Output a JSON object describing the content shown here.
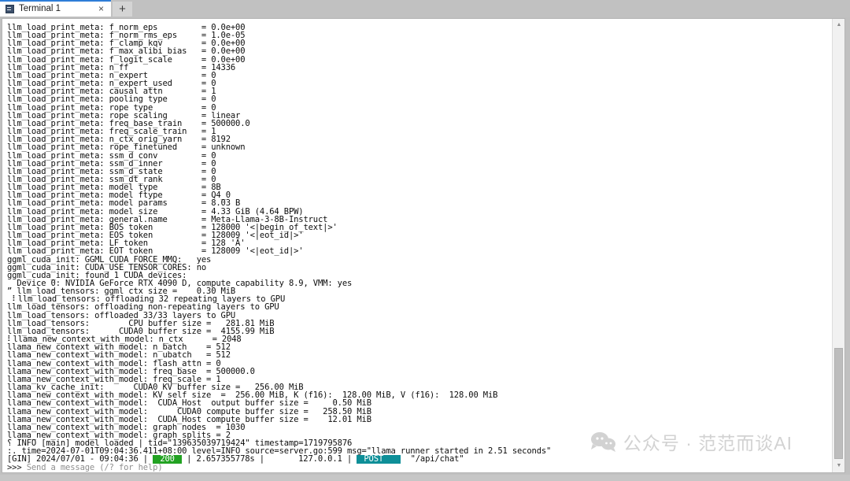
{
  "window": {
    "tab": {
      "title": "Terminal 1",
      "icon": "terminal-icon",
      "close_label": "×"
    },
    "new_tab_label": "+"
  },
  "terminal": {
    "lines": [
      "llm_load_print_meta: f_norm_eps         = 0.0e+00",
      "llm_load_print_meta: f_norm_rms_eps     = 1.0e-05",
      "llm_load_print_meta: f_clamp_kqv        = 0.0e+00",
      "llm_load_print_meta: f_max_alibi_bias   = 0.0e+00",
      "llm_load_print_meta: f_logit_scale      = 0.0e+00",
      "llm_load_print_meta: n_ff               = 14336",
      "llm_load_print_meta: n_expert           = 0",
      "llm_load_print_meta: n_expert_used      = 0",
      "llm_load_print_meta: causal attn        = 1",
      "llm_load_print_meta: pooling type       = 0",
      "llm_load_print_meta: rope type          = 0",
      "llm_load_print_meta: rope scaling       = linear",
      "llm_load_print_meta: freq_base_train    = 500000.0",
      "llm_load_print_meta: freq_scale_train   = 1",
      "llm_load_print_meta: n_ctx_orig_yarn    = 8192",
      "llm_load_print_meta: rope_finetuned     = unknown",
      "llm_load_print_meta: ssm_d_conv         = 0",
      "llm_load_print_meta: ssm_d_inner        = 0",
      "llm_load_print_meta: ssm_d_state        = 0",
      "llm_load_print_meta: ssm_dt_rank        = 0",
      "llm_load_print_meta: model type         = 8B",
      "llm_load_print_meta: model ftype        = Q4_0",
      "llm_load_print_meta: model params       = 8.03 B",
      "llm_load_print_meta: model size         = 4.33 GiB (4.64 BPW)",
      "llm_load_print_meta: general.name       = Meta-Llama-3-8B-Instruct",
      "llm_load_print_meta: BOS token          = 128000 '<|begin_of_text|>'",
      "llm_load_print_meta: EOS token          = 128009 '<|eot_id|>'",
      "llm_load_print_meta: LF token           = 128 'Ä'",
      "llm_load_print_meta: EOT token          = 128009 '<|eot_id|>'",
      "ggml_cuda_init: GGML_CUDA_FORCE_MMQ:   yes",
      "ggml_cuda_init: CUDA_USE_TENSOR_CORES: no",
      "ggml_cuda_init: found 1 CUDA devices:",
      "  Device 0: NVIDIA GeForce RTX 4090 D, compute capability 8.9, VMM: yes",
      "ˮ llm_load_tensors: ggml ctx size =    0.30 MiB",
      " ⠇llm_load_tensors: offloading 32 repeating layers to GPU",
      "llm_load_tensors: offloading non-repeating layers to GPU",
      "llm_load_tensors: offloaded 33/33 layers to GPU",
      "llm_load_tensors:        CPU buffer size =   281.81 MiB",
      "llm_load_tensors:      CUDA0 buffer size =  4155.99 MiB",
      "⠇llama_new_context_with_model: n_ctx      = 2048",
      "llama_new_context_with_model: n_batch    = 512",
      "llama_new_context_with_model: n_ubatch   = 512",
      "llama_new_context_with_model: flash_attn = 0",
      "llama_new_context_with_model: freq_base  = 500000.0",
      "llama_new_context_with_model: freq_scale = 1",
      "llama_kv_cache_init:      CUDA0 KV buffer size =   256.00 MiB",
      "llama_new_context_with_model: KV self size  =  256.00 MiB, K (f16):  128.00 MiB, V (f16):  128.00 MiB",
      "llama_new_context_with_model:  CUDA_Host  output buffer size =     0.50 MiB",
      "llama_new_context_with_model:      CUDA0 compute buffer size =   258.50 MiB",
      "llama_new_context_with_model:  CUDA_Host compute buffer size =    12.01 MiB",
      "llama_new_context_with_model: graph nodes  = 1030",
      "llama_new_context_with_model: graph splits = 2",
      "⸮ INFO [main] model loaded | tid=\"139635039719424\" timestamp=1719795876",
      ":. time=2024-07-01T09:04:36.411+08:00 level=INFO source=server.go:599 msg=\"llama runner started in 2.51 seconds\""
    ],
    "gin_line": {
      "prefix": "[GIN] 2024/07/01 - 09:04:36 |",
      "status": "200",
      "middle": "| 2.657355778s |",
      "client_ip": "127.0.0.1",
      "separator": "|",
      "method": "POST",
      "path": "\"/api/chat\""
    },
    "prompt": {
      "arrows": ">>> ",
      "placeholder": "Send a message (/? for help)"
    },
    "colors": {
      "status_badge": "#22a222",
      "method_badge": "#0e8f98",
      "text": "#0d0d0d",
      "dim_text": "#8f8f8f",
      "background": "#ffffff"
    }
  },
  "scrollbar": {
    "up_arrow": "▲",
    "down_arrow": "▼"
  },
  "watermark": {
    "text": "公众号 · 范范而谈AI",
    "icon": "wechat-bubble-icon",
    "color": "#d2d2d2"
  }
}
